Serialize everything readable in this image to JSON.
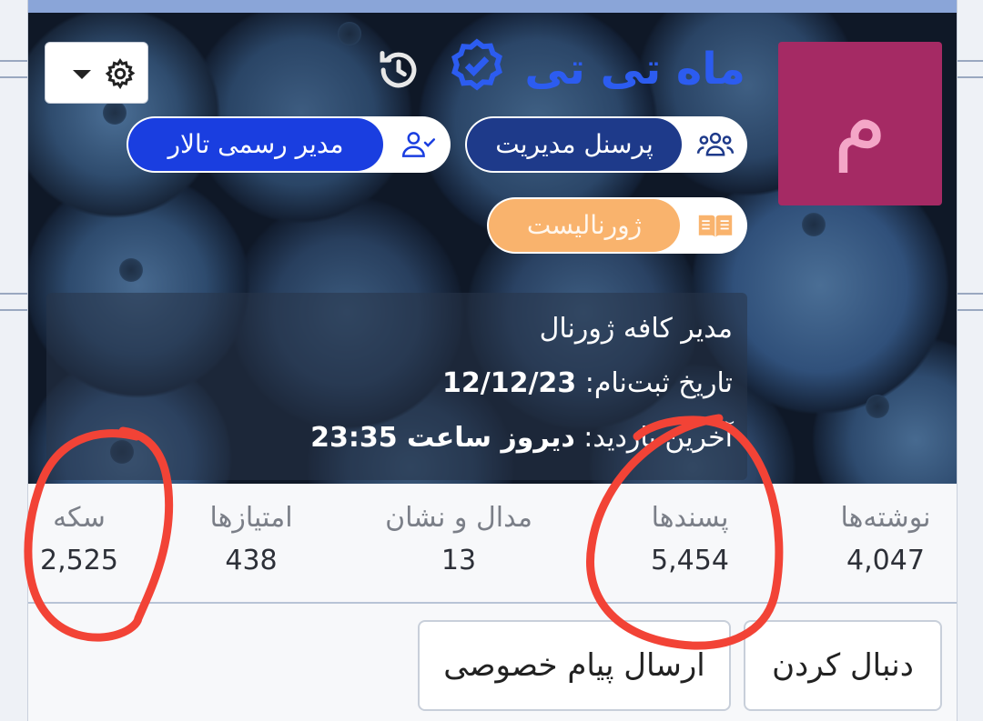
{
  "profile": {
    "display_name": "ماه تی تی",
    "avatar_letter": "م",
    "avatar_color": "#a52a64",
    "name_color": "#2c5cf0"
  },
  "toolbar": {
    "settings_icon": "gear-icon",
    "dropdown_icon": "caret-down-icon",
    "history_icon": "history-icon",
    "verified_icon": "verified-badge-icon"
  },
  "badges": {
    "staff": {
      "label": "پرسنل مدیریت",
      "icon": "users-group-icon",
      "color": "#1e3a8a"
    },
    "moderator": {
      "label": "مدیر رسمی تالار",
      "icon": "user-check-icon",
      "color": "#1a3ee0"
    },
    "journalist": {
      "label": "ژورنالیست",
      "icon": "book-open-icon",
      "color": "#f9b36d"
    }
  },
  "info": {
    "title": "مدیر کافه ژورنال",
    "registration_label": "تاریخ ثبت‌نام:",
    "registration_date": "12/12/23",
    "last_visit_label": "آخرین بازدید:",
    "last_visit_value": "دیروز ساعت 23:35"
  },
  "stats": [
    {
      "label": "نوشته‌ها",
      "value": "4,047"
    },
    {
      "label": "پسندها",
      "value": "5,454"
    },
    {
      "label": "مدال و نشان",
      "value": "13"
    },
    {
      "label": "امتیازها",
      "value": "438"
    },
    {
      "label": "سکه",
      "value": "2,525"
    }
  ],
  "actions": {
    "follow_label": "دنبال کردن",
    "private_message_label": "ارسال پیام خصوصی"
  },
  "annotations": {
    "color": "#f24336"
  }
}
